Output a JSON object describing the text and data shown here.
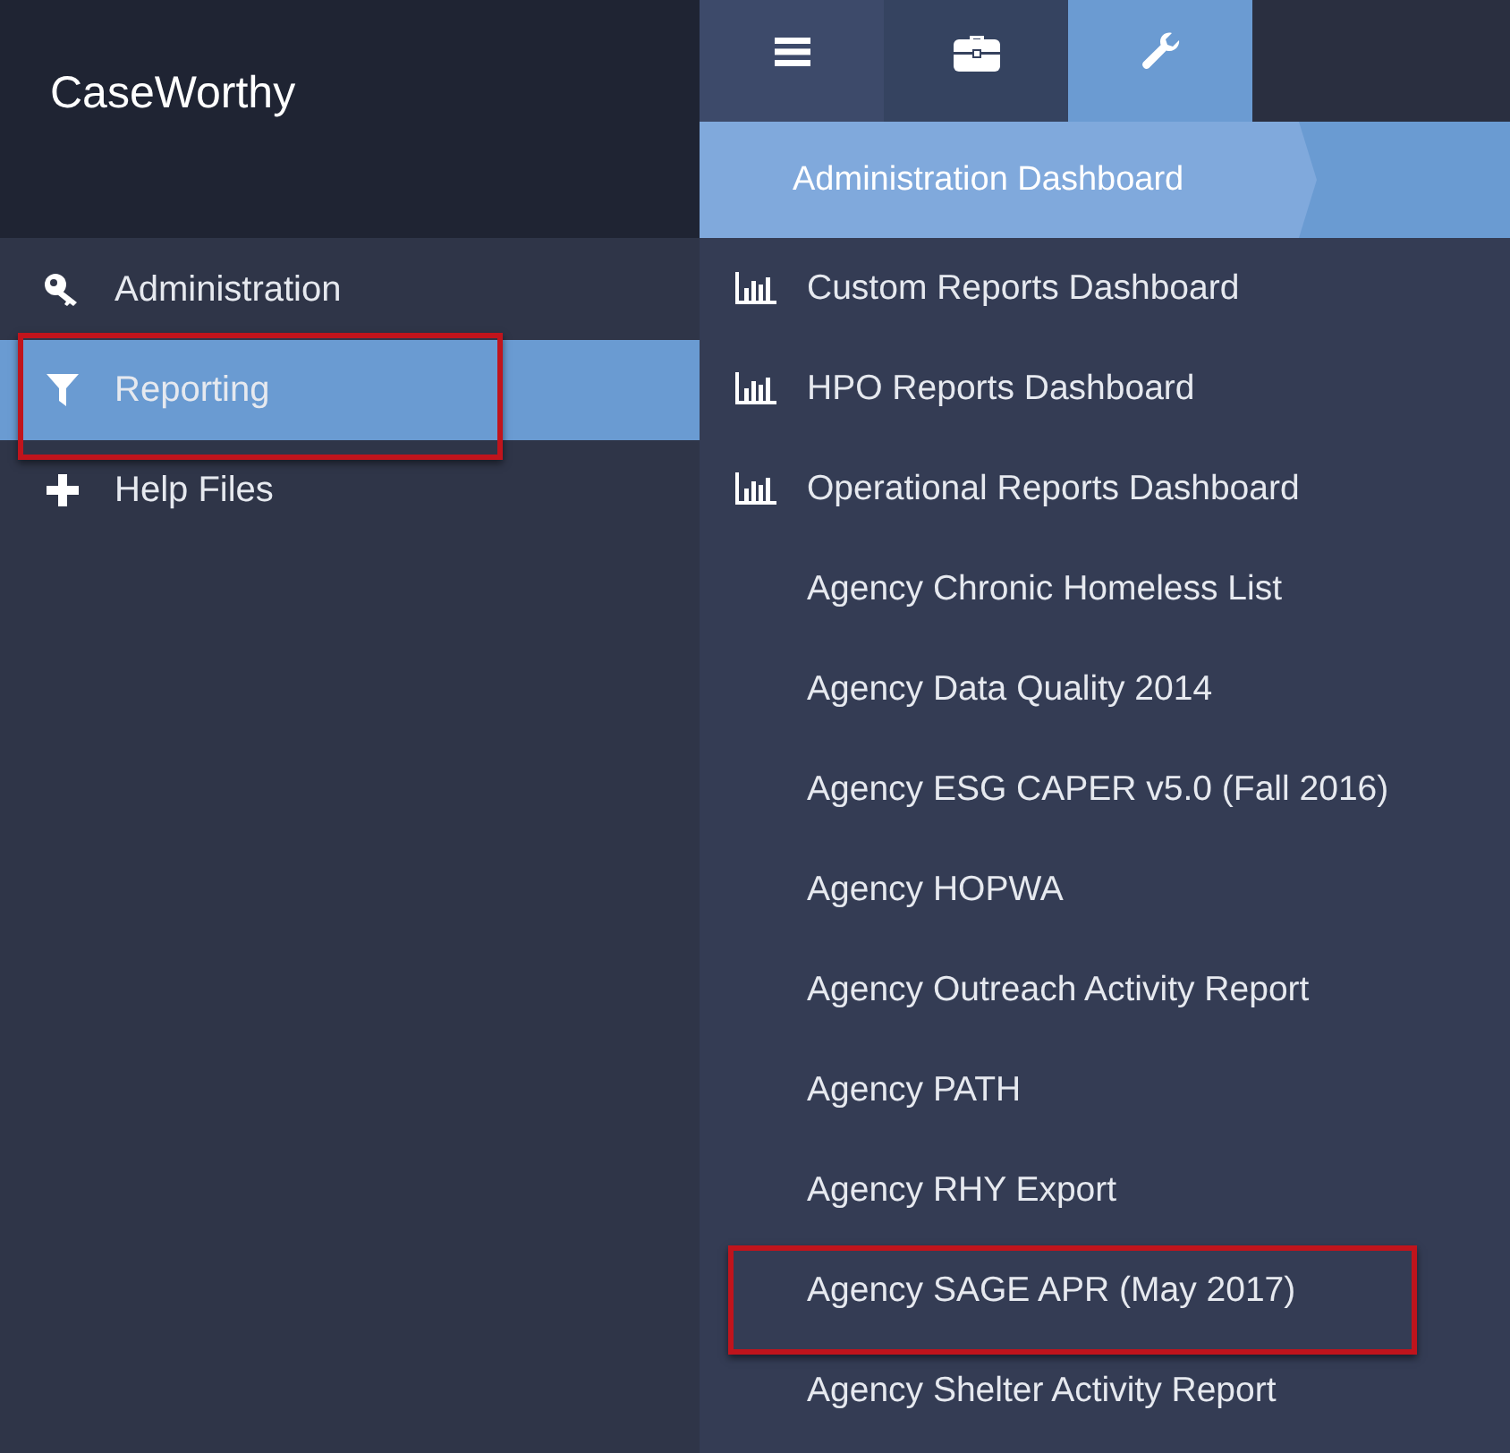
{
  "app": {
    "title": "CaseWorthy"
  },
  "toolbar_tabs": [
    {
      "selected": false
    },
    {
      "selected": false
    },
    {
      "selected": true
    }
  ],
  "breadcrumb": "Administration Dashboard",
  "sidebar": {
    "items": [
      {
        "label": "Administration",
        "selected": false,
        "highlighted": false
      },
      {
        "label": "Reporting",
        "selected": true,
        "highlighted": true
      },
      {
        "label": "Help Files",
        "selected": false,
        "highlighted": false
      }
    ]
  },
  "menu": {
    "items": [
      {
        "label": "Custom Reports Dashboard",
        "kind": "dashboard",
        "highlighted": false
      },
      {
        "label": "HPO Reports Dashboard",
        "kind": "dashboard",
        "highlighted": false
      },
      {
        "label": "Operational Reports Dashboard",
        "kind": "dashboard",
        "highlighted": false
      },
      {
        "label": "Agency Chronic Homeless List",
        "kind": "report",
        "highlighted": false
      },
      {
        "label": "Agency Data Quality 2014",
        "kind": "report",
        "highlighted": false
      },
      {
        "label": "Agency ESG CAPER v5.0 (Fall 2016)",
        "kind": "report",
        "highlighted": false
      },
      {
        "label": "Agency HOPWA",
        "kind": "report",
        "highlighted": false
      },
      {
        "label": "Agency Outreach Activity Report",
        "kind": "report",
        "highlighted": false
      },
      {
        "label": "Agency PATH",
        "kind": "report",
        "highlighted": false
      },
      {
        "label": "Agency RHY Export",
        "kind": "report",
        "highlighted": false
      },
      {
        "label": "Agency SAGE APR (May 2017)",
        "kind": "report",
        "highlighted": true
      },
      {
        "label": "Agency Shelter Activity Report",
        "kind": "report",
        "highlighted": false
      }
    ]
  }
}
